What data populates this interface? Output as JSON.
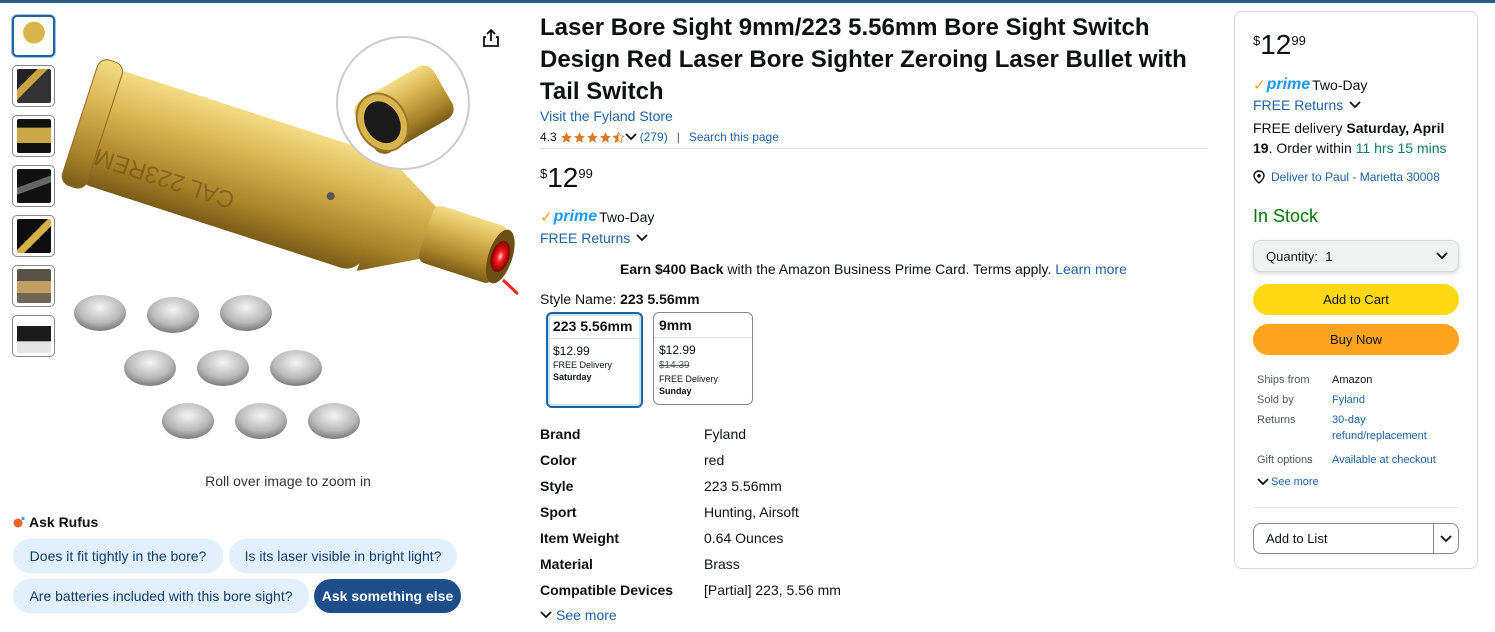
{
  "product": {
    "title": "Laser Bore Sight 9mm/223 5.56mm Bore Sight Switch Design Red Laser Bore Sighter Zeroing Laser Bullet with Tail Switch",
    "store_link": "Visit the Fyland Store",
    "rating_value": "4.3",
    "rating_count": "(279)",
    "search_page": "Search this page",
    "price": {
      "currency": "$",
      "whole": "12",
      "fraction": "99"
    },
    "prime_label": "prime",
    "prime_two_day": "Two-Day",
    "free_returns": "FREE Returns",
    "earn_bold": "Earn $400 Back",
    "earn_rest": " with the Amazon Business Prime Card. Terms apply. ",
    "earn_link": "Learn more",
    "style_name_label": "Style Name: ",
    "style_name_value": "223 5.56mm",
    "styles": [
      {
        "name": "223 5.56mm",
        "price": "$12.99",
        "delivery": "FREE Delivery",
        "day": "Saturday"
      },
      {
        "name": "9mm",
        "price": "$12.99",
        "list_price": "$14.39",
        "delivery": "FREE Delivery",
        "day": "Sunday"
      }
    ],
    "specs": [
      {
        "key": "Brand",
        "value": "Fyland"
      },
      {
        "key": "Color",
        "value": "red"
      },
      {
        "key": "Style",
        "value": "223 5.56mm"
      },
      {
        "key": "Sport",
        "value": "Hunting, Airsoft"
      },
      {
        "key": "Item Weight",
        "value": "0.64 Ounces"
      },
      {
        "key": "Material",
        "value": "Brass"
      },
      {
        "key": "Compatible Devices",
        "value": "[Partial] 223, 5.56 mm"
      }
    ],
    "see_more": "See more"
  },
  "gallery": {
    "zoom_hint": "Roll over image to zoom in",
    "engraving": "CAL 223REM",
    "thumbnail_count": 7
  },
  "rufus": {
    "title": "Ask Rufus",
    "chips": [
      "Does it fit tightly in the bore?",
      "Is its laser visible in bright light?",
      "Are batteries included with this bore sight?",
      "Ask something else"
    ]
  },
  "buybox": {
    "price": {
      "currency": "$",
      "whole": "12",
      "fraction": "99"
    },
    "prime_label": "prime",
    "prime_two_day": "Two-Day",
    "free_returns": "FREE Returns",
    "delivery_prefix": "FREE delivery ",
    "delivery_date": "Saturday, April 19",
    "order_within": ". Order within ",
    "countdown": "11 hrs 15 mins",
    "deliver_to": "Deliver to Paul - Marietta 30008",
    "stock": "In Stock",
    "quantity_label": "Quantity:",
    "quantity_value": "1",
    "add_to_cart": "Add to Cart",
    "buy_now": "Buy Now",
    "ships_from_label": "Ships from",
    "ships_from": "Amazon",
    "sold_by_label": "Sold by",
    "sold_by": "Fyland",
    "returns_label": "Returns",
    "returns_line1": "30-day",
    "returns_line2": "refund/replacement",
    "gift_label": "Gift options",
    "gift_value": "Available at checkout",
    "see_more": "See more",
    "add_to_list": "Add to List"
  },
  "colors": {
    "link": "#2162a1",
    "cart_button": "#ffd814",
    "buy_button": "#ffa41c",
    "in_stock": "#007600",
    "prime_blue": "#1a98ff"
  }
}
